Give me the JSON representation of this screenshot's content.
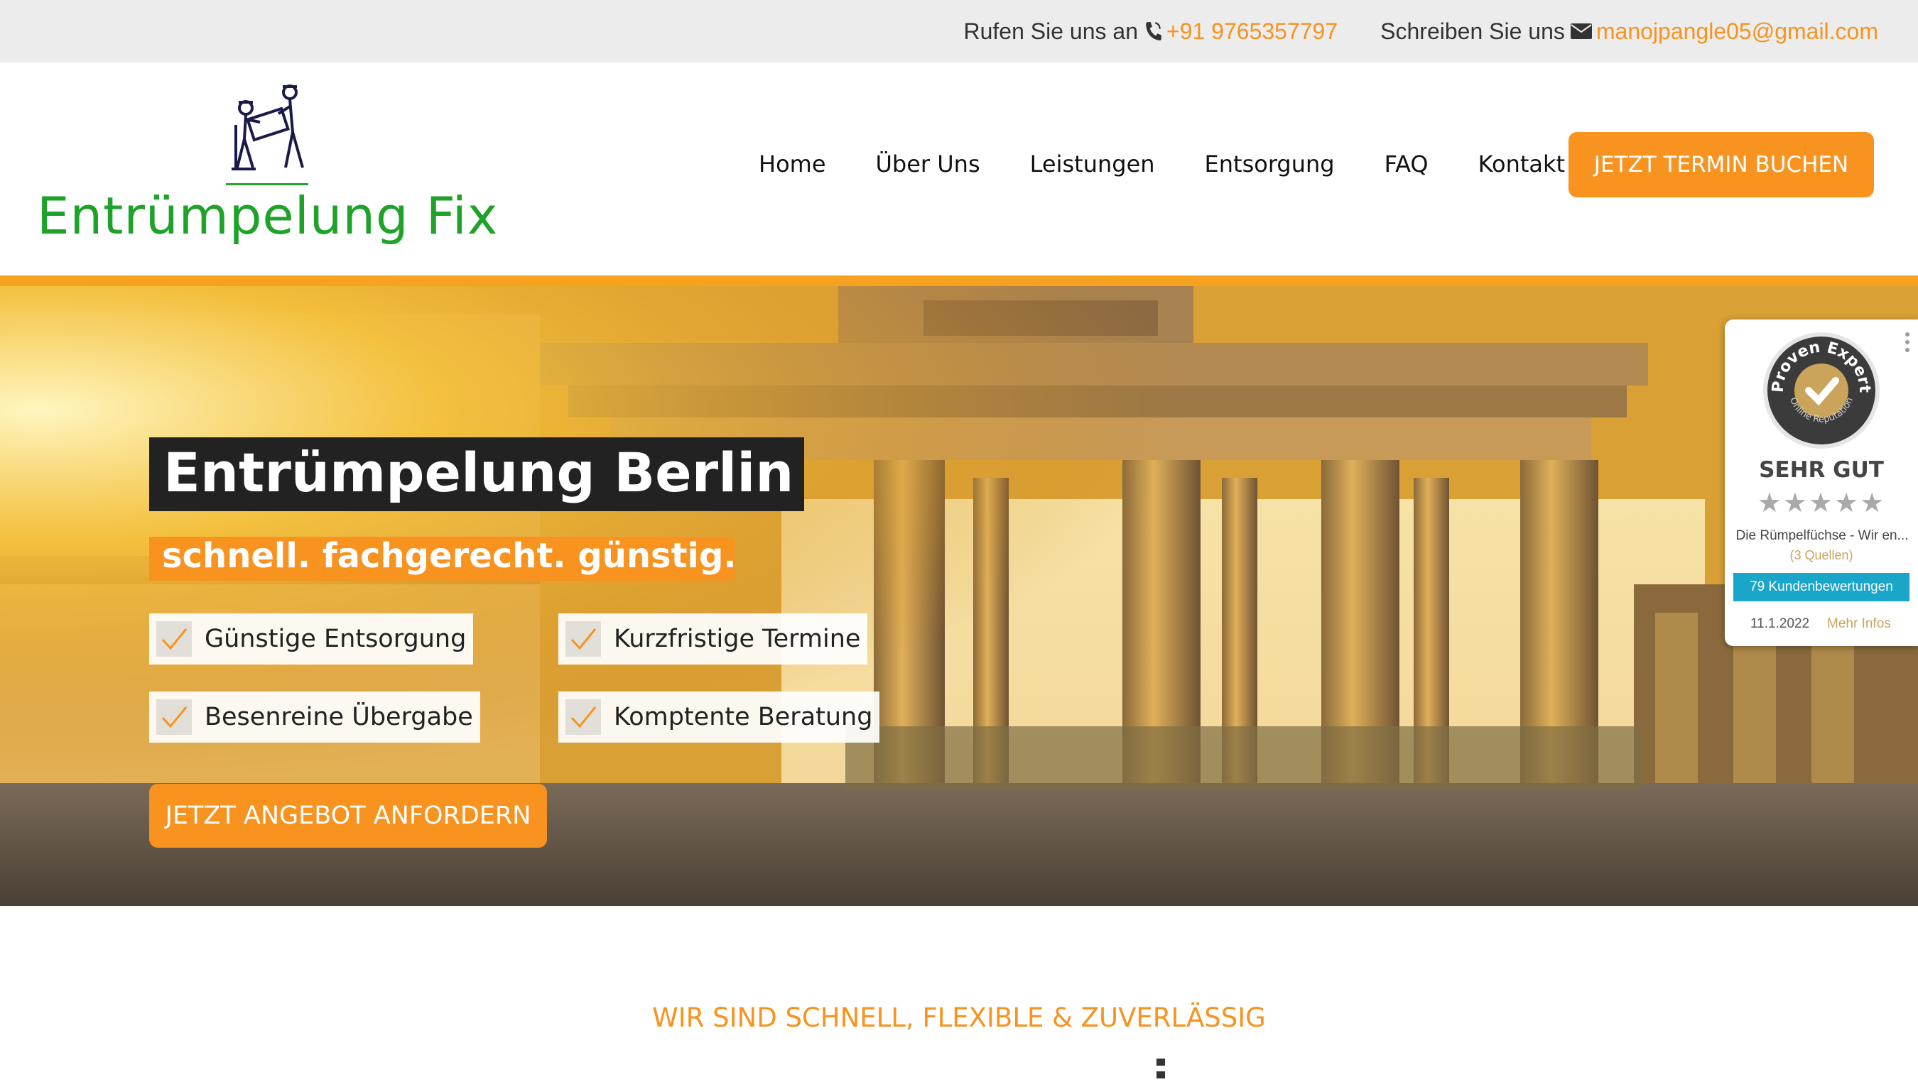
{
  "topbar": {
    "call_label": "Rufen Sie uns an",
    "phone": "+91 9765357797",
    "write_label": "Schreiben Sie uns",
    "email": "manojpangle05@gmail.com",
    "accent": "#f7931e"
  },
  "header": {
    "logo_text": "Entrümpelung Fix",
    "brand_color": "#1fa22a",
    "nav": [
      "Home",
      "Über Uns",
      "Leistungen",
      "Entsorgung",
      "FAQ",
      "Kontakt"
    ],
    "cta": "JETZT TERMIN BUCHEN"
  },
  "hero": {
    "title": "Entrümpelung Berlin",
    "subtitle": "schnell. fachgerecht. günstig.",
    "features": [
      "Günstige Entsorgung",
      "Kurzfristige Termine",
      "Besenreine Übergabe",
      "Komptente Beratung"
    ],
    "cta": "JETZT ANGEBOT ANFORDERN"
  },
  "badge": {
    "seal_top": "Proven Expert",
    "seal_bottom": "Online Reputation",
    "rating": "SEHR GUT",
    "stars": "★★★★★",
    "company": "Die Rümpelfüchse - Wir en...",
    "sources": "(3 Quellen)",
    "reviews": "79 Kundenbewertungen",
    "date": "11.1.2022",
    "more": "Mehr Infos"
  },
  "section": {
    "title": "WIR SIND SCHNELL, FLEXIBLE & ZUVERLÄSSIG"
  }
}
